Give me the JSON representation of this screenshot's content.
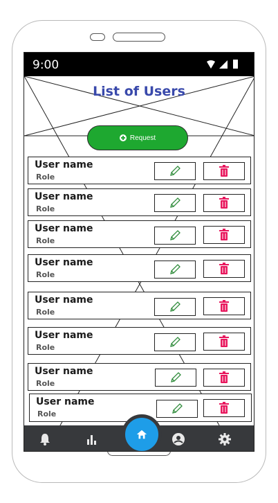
{
  "status_bar": {
    "time": "9:00"
  },
  "header": {
    "title": "List of Users"
  },
  "request_button": {
    "label": "Request"
  },
  "users": [
    {
      "name": "User name",
      "role": "Role"
    },
    {
      "name": "User name",
      "role": "Role"
    },
    {
      "name": "User name",
      "role": "Role"
    },
    {
      "name": "User name",
      "role": "Role"
    },
    {
      "name": "User name",
      "role": "Role"
    },
    {
      "name": "User name",
      "role": "Role"
    },
    {
      "name": "User name",
      "role": "Role"
    },
    {
      "name": "User name",
      "role": "Role"
    }
  ],
  "icons": {
    "edit": "pencil-icon",
    "delete": "trash-icon",
    "nav": [
      "bell-icon",
      "bar-chart-icon",
      "home-icon",
      "user-circle-icon",
      "gear-icon"
    ]
  },
  "colors": {
    "title": "#3949ab",
    "request_button": "#1ea830",
    "edit_icon": "#2e8b3a",
    "delete_icon": "#e8175d",
    "nav_bar": "#37393c",
    "home_button": "#1e9de8"
  }
}
